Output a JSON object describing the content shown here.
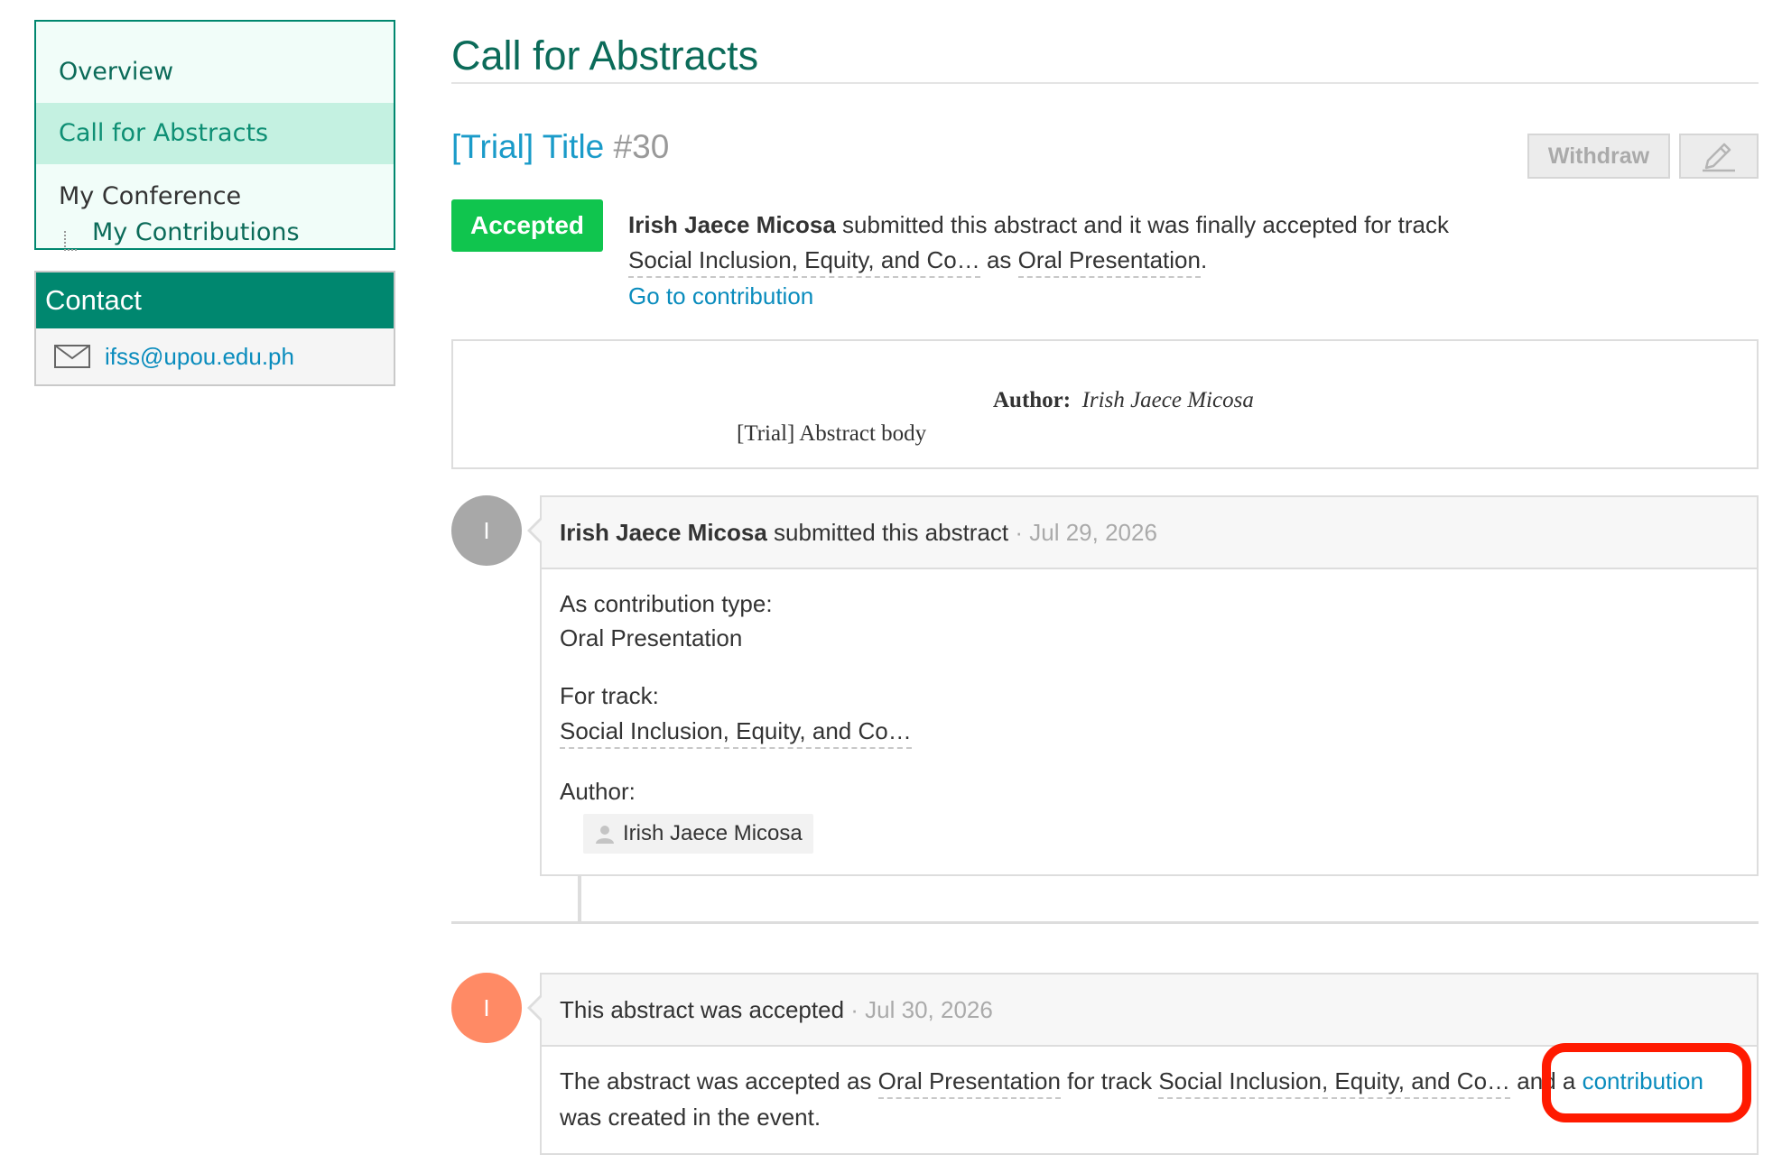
{
  "sidebar": {
    "items": [
      {
        "label": "Overview"
      },
      {
        "label": "Call for Abstracts"
      },
      {
        "label": "My Conference"
      },
      {
        "label": "My Contributions"
      }
    ],
    "contact": {
      "header": "Contact",
      "email": "ifss@upou.edu.ph"
    }
  },
  "main": {
    "page_title": "Call for Abstracts",
    "abstract_title": "[Trial] Title",
    "abstract_number": "#30",
    "withdraw_label": "Withdraw",
    "status_badge": "Accepted",
    "summary": {
      "submitter": "Irish Jaece Micosa",
      "text1": " submitted this abstract and it was finally accepted for track",
      "track": "Social Inclusion, Equity, and Co…",
      "as_text": " as ",
      "contrib_type": "Oral Presentation",
      "period": ".",
      "go_link": "Go to contribution"
    },
    "abstract_box": {
      "author_label": "Author:",
      "author_name": "Irish Jaece Micosa",
      "body": "[Trial] Abstract body"
    }
  },
  "timeline": [
    {
      "avatar_letter": "I",
      "avatar_color": "#a8a8a8",
      "actor": "Irish Jaece Micosa",
      "action": " submitted this abstract",
      "date": " · Jul 29, 2026",
      "contribution_type_label": "As contribution type:",
      "contribution_type": "Oral Presentation",
      "track_label": "For track:",
      "track": "Social Inclusion, Equity, and Co…",
      "author_label": "Author:",
      "author": "Irish Jaece Micosa"
    },
    {
      "avatar_letter": "I",
      "avatar_color": "#ff8a65",
      "action": "This abstract was accepted",
      "date": " · Jul 30, 2026",
      "body_prefix": "The abstract was accepted as ",
      "contrib_type": "Oral Presentation",
      "for_track": " for track ",
      "track": "Social Inclusion, Equity, and Co…",
      "and_a": " and a ",
      "contribution_link": "contribution",
      "suffix": "was created in the event."
    }
  ],
  "colors": {
    "brand_green": "#00876f",
    "link_blue": "#0a8cbd",
    "accepted_green": "#10c54e",
    "highlight_red": "#ff1a00"
  }
}
